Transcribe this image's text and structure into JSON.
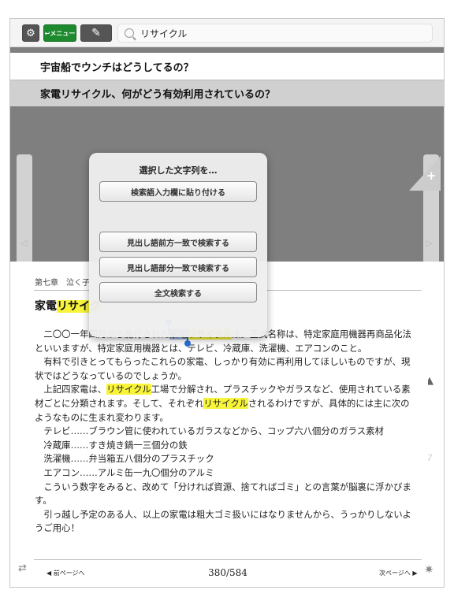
{
  "toolbar": {
    "menu_label": "メニュー",
    "search_value": "リサイクル"
  },
  "results": [
    "宇宙船でウンチはどうしてるの？",
    "家電リサイクル、何がどう有効利用されているの？"
  ],
  "popup": {
    "title": "選択した文字列を…",
    "paste_button": "検索語入力欄に貼り付ける",
    "prefix_button": "見出し語前方一致で検索する",
    "partial_button": "見出し語部分一致で検索する",
    "fulltext_button": "全文検索する"
  },
  "page": {
    "chapter": "第七章　泣く子",
    "title_pre": "家電",
    "title_hl": "リサイク",
    "body": {
      "l1_a": "二〇〇一年四月から施行された",
      "l1_sel": "家電",
      "l1_hl": "リサイクル",
      "l1_b": "法。正式名称は、特定家庭用機器再商品化法",
      "l2": "といいますが、特定家庭用機器とは、テレビ、冷蔵庫、洗濯機、エアコンのこと。",
      "l3": "有料で引きとってもらったこれらの家電、しっかり有効に再利用してほしいものですが、現",
      "l4": "状ではどうなっているのでしょうか。",
      "l5_a": "上記四家電は、",
      "l5_hl": "リサイクル",
      "l5_b": "工場で分解され、プラスチックやガラスなど、使用されている素",
      "l6_a": "材ごとに分類されます。そして、それぞれ",
      "l6_hl": "リサイクル",
      "l6_b": "されるわけですが、具体的には主に次の",
      "l7": "ようなものに生まれ変わります。",
      "l8": "テレビ……ブラウン管に使われているガラスなどから、コップ六八個分のガラス素材",
      "l9": "冷蔵庫……すき焼き鍋一三個分の鉄",
      "l10": "洗濯機……弁当箱五八個分のプラスチック",
      "l11": "エアコン……アルミ缶一九〇個分のアルミ",
      "l12": "こういう数字をみると、改めて「分ければ資源、捨てればゴミ」との言葉が脳裏に浮かびま",
      "l13": "す。",
      "l14": "引っ越し予定のある人、以上の家電は粗大ゴミ扱いにはなりませんから、うっかりしないよ",
      "l15": "うご用心！"
    },
    "prev": "前ページへ",
    "next": "次ページへ",
    "page_number": "380/584"
  }
}
